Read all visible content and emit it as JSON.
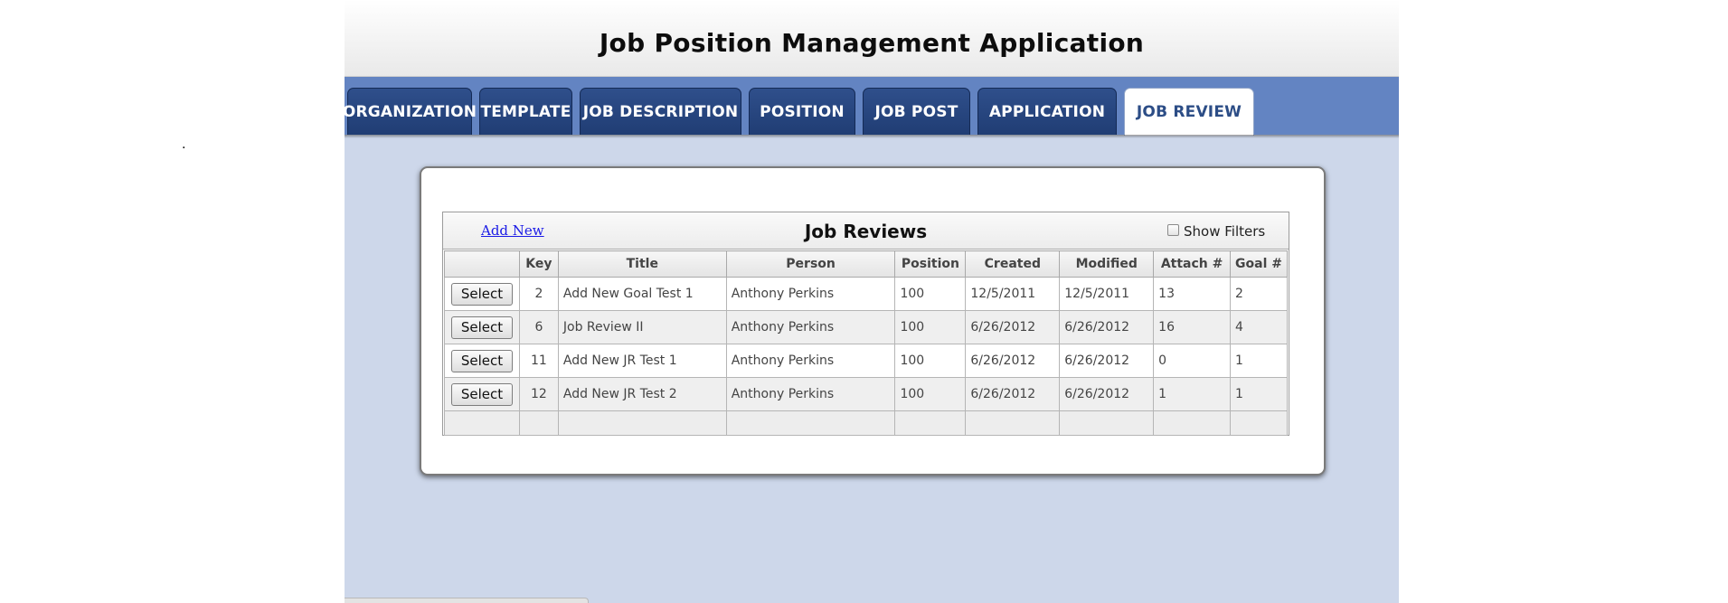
{
  "app": {
    "title": "Job Position Management Application"
  },
  "stray_text": ".",
  "tabs": [
    {
      "label": "ORGANIZATION",
      "active": false
    },
    {
      "label": "TEMPLATE",
      "active": false
    },
    {
      "label": "JOB DESCRIPTION",
      "active": false
    },
    {
      "label": "POSITION",
      "active": false
    },
    {
      "label": "JOB POST",
      "active": false
    },
    {
      "label": "APPLICATION",
      "active": false
    },
    {
      "label": "JOB REVIEW",
      "active": true
    }
  ],
  "grid": {
    "title": "Job Reviews",
    "add_new_label": "Add New",
    "show_filters_label": "Show Filters",
    "show_filters_checked": false,
    "select_label": "Select",
    "columns": [
      "",
      "Key",
      "Title",
      "Person",
      "Position",
      "Created",
      "Modified",
      "Attach #",
      "Goal #"
    ],
    "rows": [
      {
        "key": "2",
        "title": "Add New Goal Test 1",
        "person": "Anthony Perkins",
        "position": "100",
        "created": "12/5/2011",
        "modified": "12/5/2011",
        "attach": "13",
        "goal": "2"
      },
      {
        "key": "6",
        "title": "Job Review II",
        "person": "Anthony Perkins",
        "position": "100",
        "created": "6/26/2012",
        "modified": "6/26/2012",
        "attach": "16",
        "goal": "4"
      },
      {
        "key": "11",
        "title": "Add New JR Test 1",
        "person": "Anthony Perkins",
        "position": "100",
        "created": "6/26/2012",
        "modified": "6/26/2012",
        "attach": "0",
        "goal": "1"
      },
      {
        "key": "12",
        "title": "Add New JR Test 2",
        "person": "Anthony Perkins",
        "position": "100",
        "created": "6/26/2012",
        "modified": "6/26/2012",
        "attach": "1",
        "goal": "1"
      }
    ]
  },
  "colors": {
    "tab_bar": "#6384c2",
    "tab_inactive": "#2f4f8b",
    "tab_active_text": "#2c4d86",
    "content_bg": "#cdd7ea"
  }
}
